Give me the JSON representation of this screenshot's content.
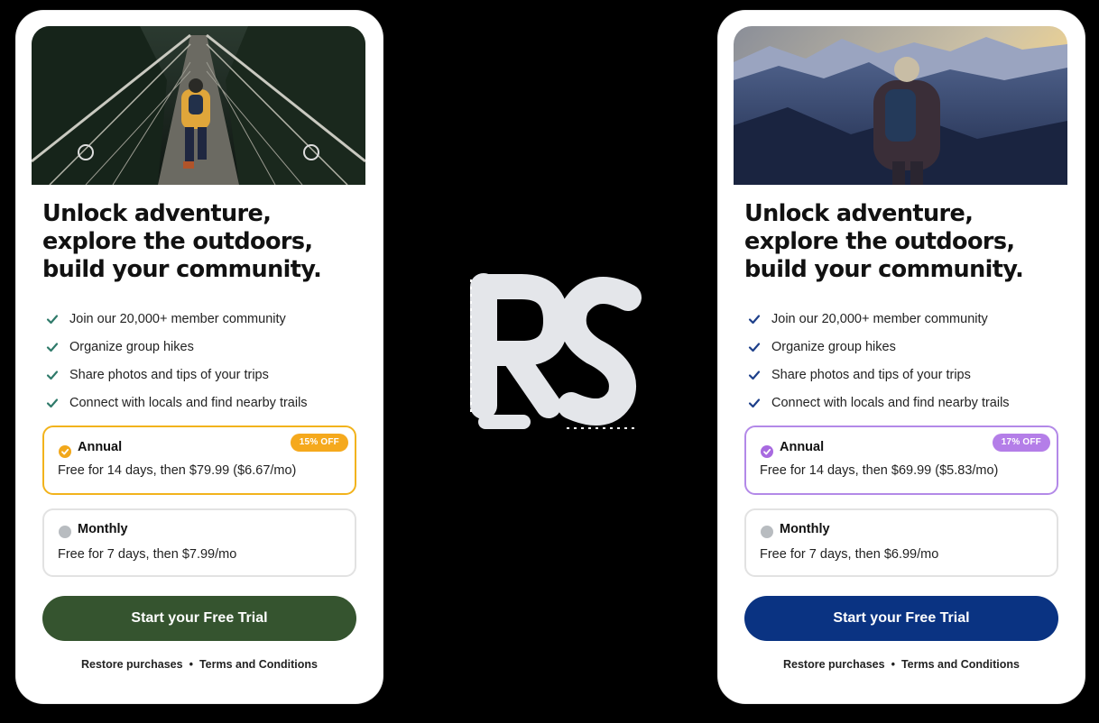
{
  "left": {
    "headline": [
      "Unlock adventure,",
      "explore the outdoors,",
      "build your community."
    ],
    "features": [
      "Join our 20,000+ member community",
      "Organize group hikes",
      "Share photos and tips of your trips",
      "Connect with locals and find nearby trails"
    ],
    "annual": {
      "name": "Annual",
      "badge": "15% OFF",
      "desc": "Free for 14 days, then $79.99 ($6.67/mo)"
    },
    "monthly": {
      "name": "Monthly",
      "desc": "Free for 7 days, then $7.99/mo"
    },
    "cta": "Start your Free Trial",
    "footer": {
      "restore": "Restore purchases",
      "separator": "•",
      "terms": "Terms and Conditions"
    },
    "colors": {
      "accent": "#f2b31c",
      "button": "#35542f",
      "check": "#2f7a6a"
    }
  },
  "right": {
    "headline": [
      "Unlock adventure,",
      "explore the outdoors,",
      "build your community."
    ],
    "features": [
      "Join our 20,000+ member community",
      "Organize group hikes",
      "Share photos and tips of your trips",
      "Connect with locals and find nearby trails"
    ],
    "annual": {
      "name": "Annual",
      "badge": "17% OFF",
      "desc": "Free for 14 days, then $69.99 ($5.83/mo)"
    },
    "monthly": {
      "name": "Monthly",
      "desc": "Free for 7 days, then $6.99/mo"
    },
    "cta": "Start your Free Trial",
    "footer": {
      "restore": "Restore purchases",
      "separator": "•",
      "terms": "Terms and Conditions"
    },
    "colors": {
      "accent": "#b389e8",
      "button": "#0a3382",
      "check": "#1d3f8a"
    }
  },
  "logo": {
    "text": "RC",
    "icon": "revenuecat-logo"
  },
  "icons": {
    "check": "check-icon",
    "selected": "selected-check-icon",
    "unselected": "radio-unselected-icon"
  }
}
